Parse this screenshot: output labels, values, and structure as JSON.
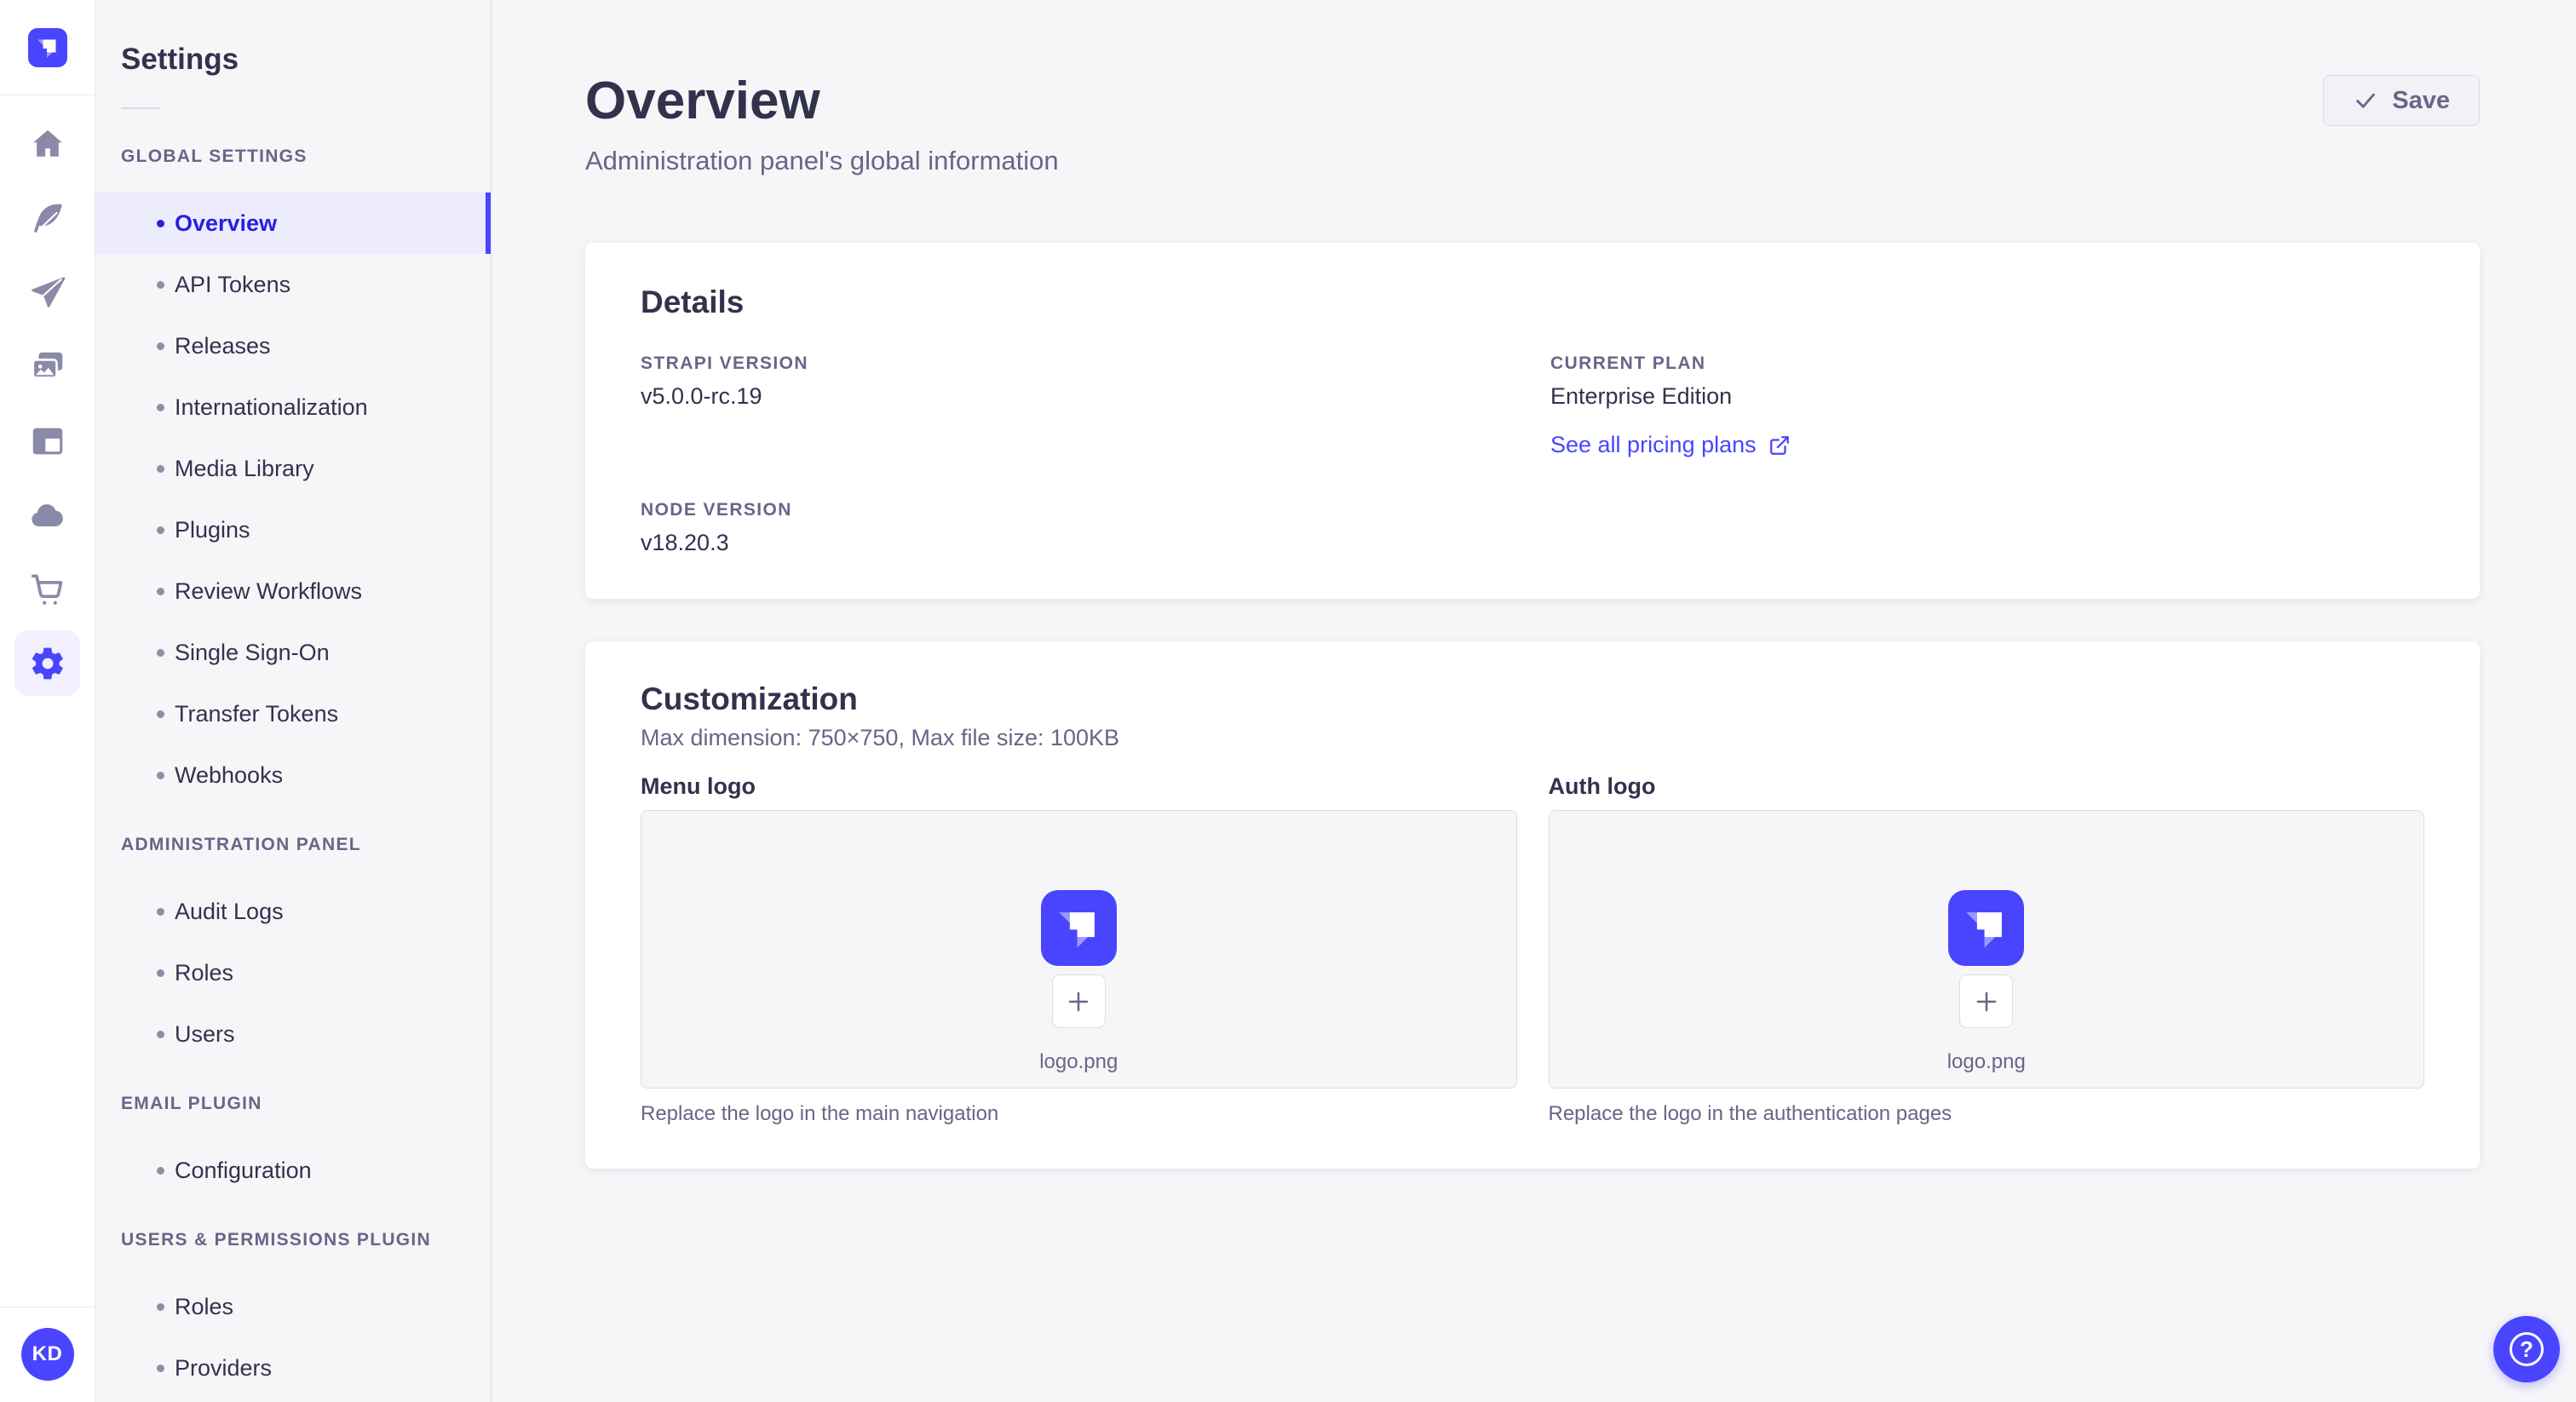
{
  "brand": {
    "primary_color": "#4945ff",
    "active_text_color": "#271fe0"
  },
  "rail": {
    "logo_icon": "strapi-logo",
    "icons": [
      "home-icon",
      "feather-icon",
      "paper-plane-icon",
      "media-images-icon",
      "layout-icon",
      "cloud-icon",
      "cart-icon",
      "gear-icon"
    ],
    "active_icon": "gear-icon",
    "avatar_initials": "KD"
  },
  "sidebar": {
    "title": "Settings",
    "active_item": "Overview",
    "sections": [
      {
        "label": "GLOBAL SETTINGS",
        "items": [
          "Overview",
          "API Tokens",
          "Releases",
          "Internationalization",
          "Media Library",
          "Plugins",
          "Review Workflows",
          "Single Sign-On",
          "Transfer Tokens",
          "Webhooks"
        ]
      },
      {
        "label": "ADMINISTRATION PANEL",
        "items": [
          "Audit Logs",
          "Roles",
          "Users"
        ]
      },
      {
        "label": "EMAIL PLUGIN",
        "items": [
          "Configuration"
        ]
      },
      {
        "label": "USERS & PERMISSIONS PLUGIN",
        "items": [
          "Roles",
          "Providers"
        ]
      }
    ]
  },
  "header": {
    "title": "Overview",
    "subtitle": "Administration panel's global information",
    "save_label": "Save",
    "save_icon": "check-icon"
  },
  "details": {
    "title": "Details",
    "strapi_version_label": "STRAPI VERSION",
    "strapi_version": "v5.0.0-rc.19",
    "node_version_label": "NODE VERSION",
    "node_version": "v18.20.3",
    "plan_label": "CURRENT PLAN",
    "plan": "Enterprise Edition",
    "pricing_link": "See all pricing plans",
    "pricing_link_icon": "external-link-icon"
  },
  "customization": {
    "title": "Customization",
    "subtitle": "Max dimension: 750×750, Max file size: 100KB",
    "menu_logo": {
      "label": "Menu logo",
      "filename": "logo.png",
      "hint": "Replace the logo in the main navigation",
      "add_icon": "plus-icon"
    },
    "auth_logo": {
      "label": "Auth logo",
      "filename": "logo.png",
      "hint": "Replace the logo in the authentication pages",
      "add_icon": "plus-icon"
    }
  },
  "help": {
    "icon": "question-mark-icon"
  }
}
